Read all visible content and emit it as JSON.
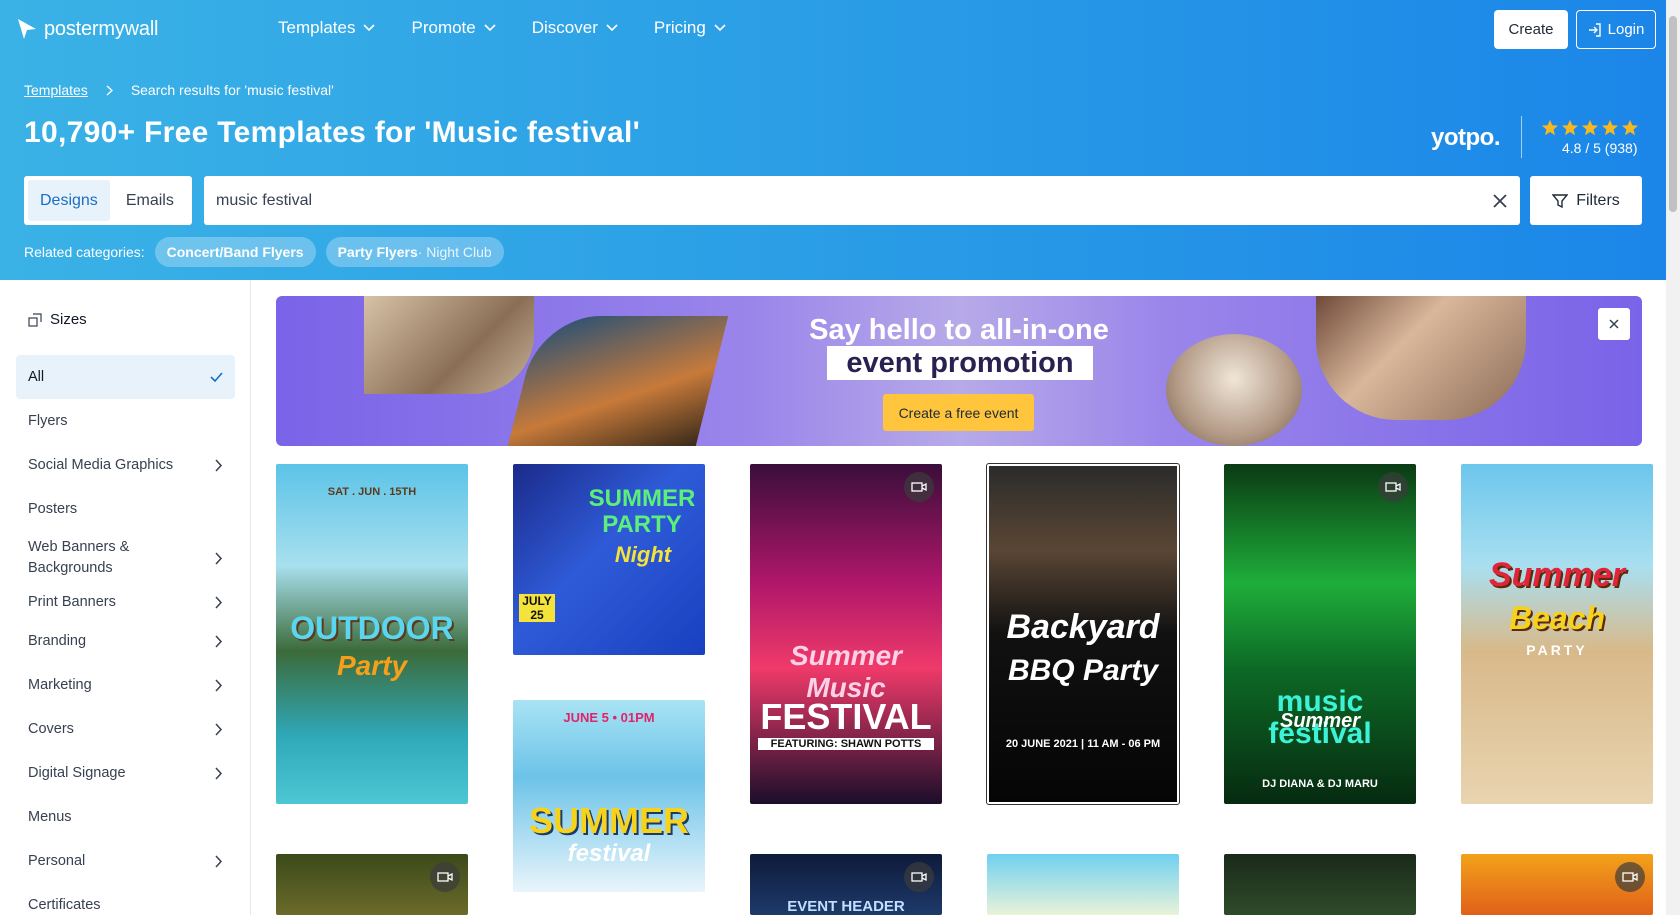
{
  "brand": {
    "name": "postermywall"
  },
  "nav": {
    "items": [
      {
        "label": "Templates"
      },
      {
        "label": "Promote"
      },
      {
        "label": "Discover"
      },
      {
        "label": "Pricing"
      }
    ],
    "create_label": "Create",
    "login_label": "Login"
  },
  "breadcrumb": {
    "root": "Templates",
    "current": "Search results for 'music festival'"
  },
  "page_title": "10,790+ Free Templates for 'Music festival'",
  "reviews": {
    "provider": "yotpo.",
    "rating_text": "4.8 / 5 (938)",
    "stars": 5
  },
  "tabs": {
    "designs": "Designs",
    "emails": "Emails",
    "active": "Designs"
  },
  "search": {
    "value": "music festival"
  },
  "filters_label": "Filters",
  "related": {
    "label": "Related categories:",
    "pills": [
      {
        "main": "Concert/Band Flyers",
        "sub": ""
      },
      {
        "main": "Party Flyers",
        "sub": " · Night Club"
      }
    ]
  },
  "sidebar": {
    "heading": "Sizes",
    "items": [
      {
        "label": "All",
        "active": true
      },
      {
        "label": "Flyers"
      },
      {
        "label": "Social Media Graphics",
        "chevron": true
      },
      {
        "label": "Posters"
      },
      {
        "label": "Web Banners & Backgrounds",
        "chevron": true
      },
      {
        "label": "Print Banners",
        "chevron": true
      },
      {
        "label": "Branding",
        "chevron": true
      },
      {
        "label": "Marketing",
        "chevron": true
      },
      {
        "label": "Covers",
        "chevron": true
      },
      {
        "label": "Digital Signage",
        "chevron": true
      },
      {
        "label": "Menus"
      },
      {
        "label": "Personal",
        "chevron": true
      },
      {
        "label": "Certificates"
      }
    ]
  },
  "banner": {
    "line1": "Say hello to all-in-one",
    "line2": "event promotion",
    "cta": "Create a free event"
  },
  "templates": [
    {
      "title": "OUTDOOR",
      "subtitle": "Party",
      "tag": "SAT . JUN . 15TH"
    },
    {
      "title": "SUMMER PARTY",
      "subtitle": "Night",
      "tag": "JULY 25"
    },
    {
      "title": "SUMMER",
      "subtitle": "festival",
      "tag": "JUNE 5 • 01PM"
    },
    {
      "title": "FESTIVAL",
      "subtitle": "Summer Music",
      "tag": "FEATURING: SHAWN POTTS"
    },
    {
      "title": "Backyard",
      "subtitle": "BBQ Party",
      "tag": "20 JUNE 2021 | 11 AM - 06 PM"
    },
    {
      "title": "music festival",
      "subtitle": "Summer",
      "tag": "DJ DIANA & DJ MARU"
    },
    {
      "title": "Summer",
      "subtitle": "Beach",
      "tag": "PARTY"
    },
    {
      "title": "EVENT HEADER",
      "subtitle": "",
      "tag": ""
    }
  ],
  "colors": {
    "hero_start": "#3ab2e6",
    "hero_end": "#1b86e8",
    "accent": "#1a6fc4",
    "cta": "#ffc63d",
    "banner": "#7a63e8"
  }
}
